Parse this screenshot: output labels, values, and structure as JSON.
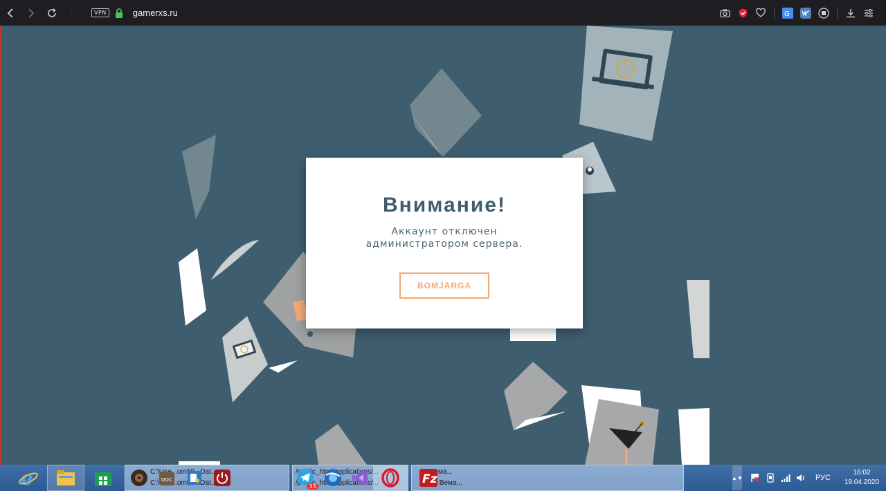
{
  "browser": {
    "vpn_label": "VPN",
    "url": "gamerxs.ru"
  },
  "modal": {
    "title": "Внимание!",
    "message_line1": "Аккаунт отключен",
    "message_line2": "администратором сервера.",
    "button_label": "BOMJARGA"
  },
  "taskbar": {
    "group1": {
      "line1": "C:\\Use...om59...Dat...",
      "line2": "C:\\Use...om59...Dat..."
    },
    "group2": {
      "line1": "/public_html/applications/...",
      "line2": "/public_html/applications/...",
      "badge": "33"
    },
    "group3": {
      "line1": "03 Вема...",
      "line2": "3 178 Вема..."
    },
    "tray": {
      "language": "РУС",
      "time": "16:02",
      "date": "19.04.2020"
    }
  },
  "colors": {
    "page_background": "#3e5d6e",
    "title_color": "#3e5d6e",
    "button_accent": "#f2a978"
  }
}
